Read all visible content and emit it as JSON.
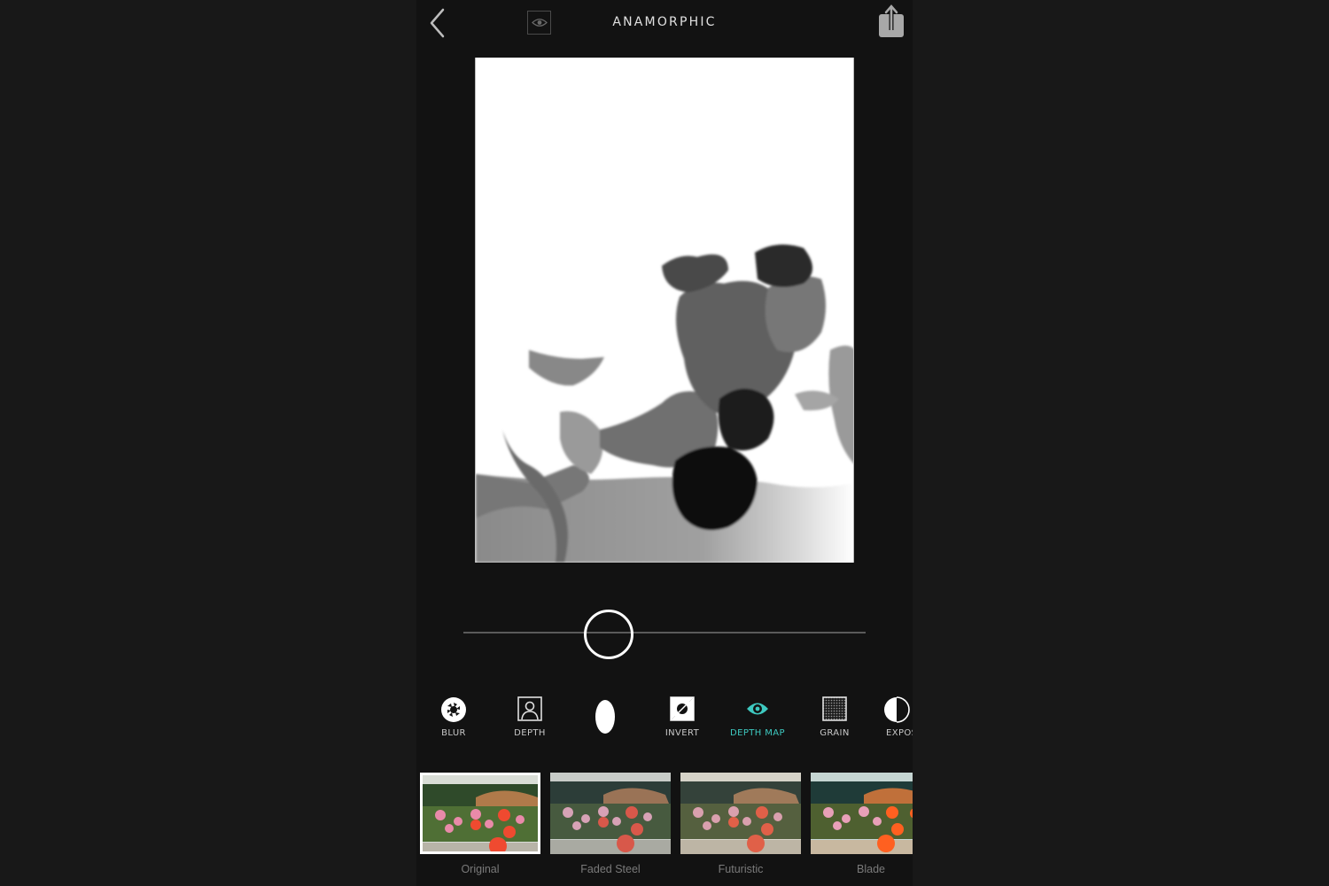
{
  "header": {
    "title": "ANAMORPHIC",
    "back_icon": "chevron-left-icon",
    "preview_toggle_icon": "eye-icon",
    "share_icon": "share-icon"
  },
  "preview": {
    "mode": "depth map",
    "description": "grayscale depth map of flowers"
  },
  "slider": {
    "value": 0.36
  },
  "tools": [
    {
      "label": "BLUR",
      "icon": "aperture-icon",
      "active": false
    },
    {
      "label": "DEPTH",
      "icon": "portrait-frame-icon",
      "active": false
    },
    {
      "label": "",
      "icon": "ellipse-shape-icon",
      "active": false
    },
    {
      "label": "INVERT",
      "icon": "invert-icon",
      "active": false
    },
    {
      "label": "DEPTH MAP",
      "icon": "eye-icon",
      "active": true
    },
    {
      "label": "GRAIN",
      "icon": "grain-icon",
      "active": false
    },
    {
      "label": "EXPOS",
      "icon": "exposure-icon",
      "active": false
    }
  ],
  "filters": [
    {
      "name": "Original",
      "selected": true
    },
    {
      "name": "Faded Steel",
      "selected": false
    },
    {
      "name": "Futuristic",
      "selected": false
    },
    {
      "name": "Blade",
      "selected": false
    }
  ],
  "colors": {
    "accent": "#3ec9c0",
    "app_bg": "#121212",
    "outer_bg": "#181818"
  }
}
